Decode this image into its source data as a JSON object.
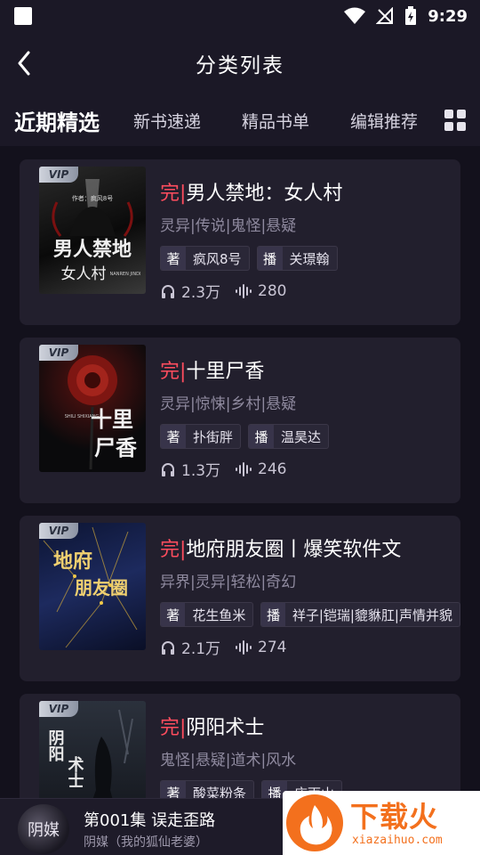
{
  "status_bar": {
    "time": "9:29"
  },
  "header": {
    "title": "分类列表"
  },
  "tabs": [
    {
      "label": "近期精选"
    },
    {
      "label": "新书速递"
    },
    {
      "label": "精品书单"
    },
    {
      "label": "编辑推荐"
    }
  ],
  "books": [
    {
      "vip": "VIP",
      "status": "完|",
      "title": "男人禁地：女人村",
      "tags": "灵异|传说|鬼怪|悬疑",
      "author_key": "著",
      "author": "疯风8号",
      "narrator_key": "播",
      "narrator": "关璟翰",
      "plays": "2.3万",
      "episodes": "280",
      "cover": {
        "main": "男人禁地",
        "sub": "女人村",
        "top": "作者：疯风8号",
        "mark": "NANREN JINDI",
        "c1": "#151515",
        "c2": "#4a4a4a"
      }
    },
    {
      "vip": "VIP",
      "status": "完|",
      "title": "十里尸香",
      "tags": "灵异|惊悚|乡村|悬疑",
      "author_key": "著",
      "author": "扑街胖",
      "narrator_key": "播",
      "narrator": "温昊达",
      "plays": "1.3万",
      "episodes": "246",
      "cover": {
        "main": "十里",
        "sub": "尸香",
        "top": "",
        "mark": "SHILI SHIXIANG",
        "c1": "#0e0e10",
        "c2": "#7a1a14"
      }
    },
    {
      "vip": "VIP",
      "status": "完|",
      "title": "地府朋友圈丨爆笑软件文",
      "tags": "异界|灵异|轻松|奇幻",
      "author_key": "著",
      "author": "花生鱼米",
      "narrator_key": "播",
      "narrator": "祥子|铠瑞|貔貅肛|声情并貌",
      "plays": "2.1万",
      "episodes": "274",
      "cover": {
        "main": "地府",
        "sub": "朋友圈",
        "top": "",
        "mark": "",
        "c1": "#0c1432",
        "c2": "#1d2a5e"
      }
    },
    {
      "vip": "VIP",
      "status": "完|",
      "title": "阴阳术士",
      "tags": "鬼怪|悬疑|道术|风水",
      "author_key": "著",
      "author": "酸菜粉条",
      "narrator_key": "播",
      "narrator": "庄雨山",
      "plays": "",
      "episodes": "",
      "cover": {
        "main": "阴阳",
        "sub": "术士",
        "top": "",
        "mark": "",
        "c1": "#1a1e26",
        "c2": "#5c6370"
      }
    }
  ],
  "player": {
    "disc_text": "阴媒",
    "episode": "第001集 误走歪路",
    "book": "阴媒（我的狐仙老婆）"
  },
  "watermark": {
    "text": "下载火",
    "domain": "xiazaihuo.com",
    "color": "#f3701d"
  }
}
